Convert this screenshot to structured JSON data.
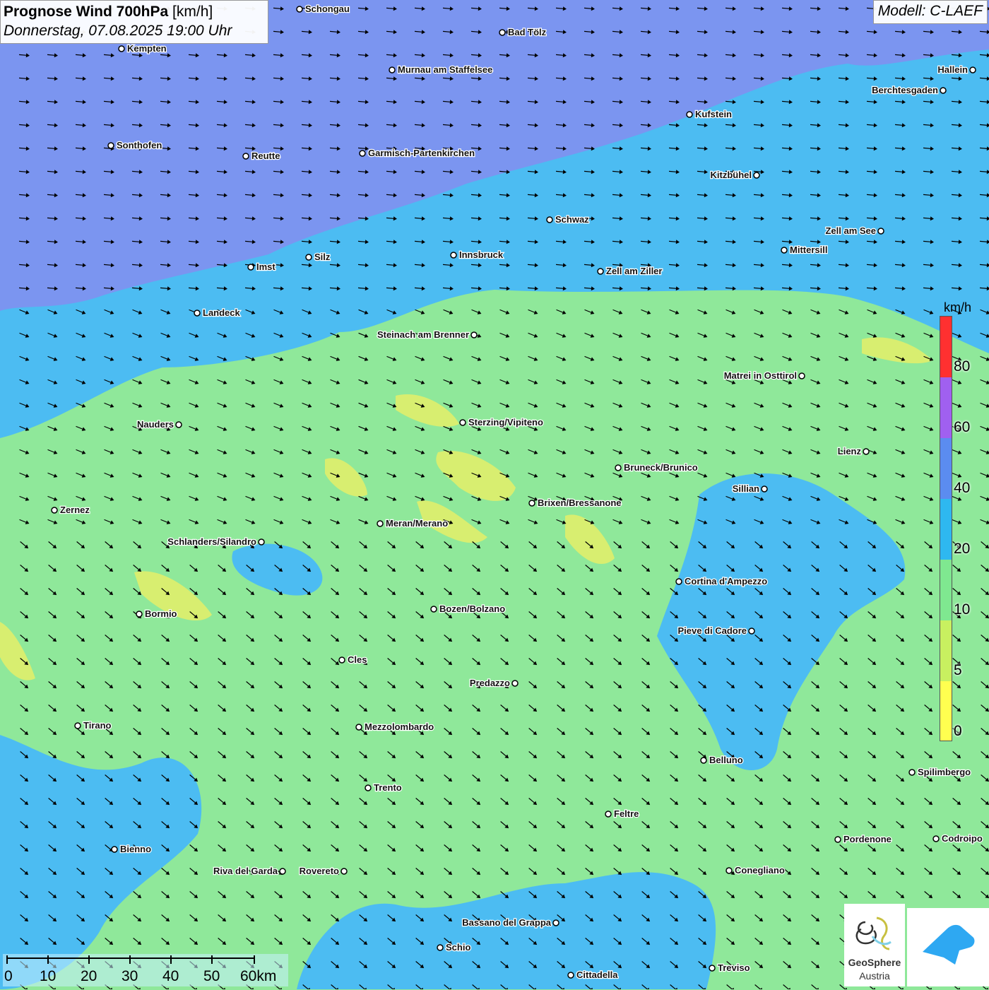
{
  "title": {
    "main_bold": "Prognose Wind 700hPa",
    "unit": "[km/h]",
    "datetime": "Donnerstag, 07.08.2025 19:00 Uhr"
  },
  "model": "Modell: C-LAEF",
  "legend": {
    "unit": "km/h",
    "ticks": [
      "80",
      "60",
      "40",
      "20",
      "10",
      "5",
      "0"
    ],
    "colors": [
      "#ff3030",
      "#a060f0",
      "#5b8cf0",
      "#2eb8f0",
      "#7fe890",
      "#c8f060",
      "#ffff50"
    ]
  },
  "scalebar": {
    "labels": [
      "0",
      "10",
      "20",
      "30",
      "40",
      "50",
      "60km"
    ]
  },
  "colors": {
    "wind_strong": "#7b95f0",
    "wind_medium": "#4cbcf2",
    "wind_light": "#8fe89a",
    "wind_calm": "#d8ee70",
    "arrow": "#000000"
  },
  "cities": [
    {
      "name": "Schongau"
    },
    {
      "name": "Bad Tölz"
    },
    {
      "name": "Kempten"
    },
    {
      "name": "Murnau am Staffelsee"
    },
    {
      "name": "Hallein"
    },
    {
      "name": "Berchtesgaden"
    },
    {
      "name": "Kufstein"
    },
    {
      "name": "Sonthofen"
    },
    {
      "name": "Reutte"
    },
    {
      "name": "Garmisch-Partenkirchen"
    },
    {
      "name": "Kitzbühel"
    },
    {
      "name": "Schwaz"
    },
    {
      "name": "Zell am See"
    },
    {
      "name": "Mittersill"
    },
    {
      "name": "Imst"
    },
    {
      "name": "Silz"
    },
    {
      "name": "Innsbruck"
    },
    {
      "name": "Zell am Ziller"
    },
    {
      "name": "Landeck"
    },
    {
      "name": "Steinach am Brenner"
    },
    {
      "name": "Matrei in Osttirol"
    },
    {
      "name": "Nauders"
    },
    {
      "name": "Sterzing/Vipiteno"
    },
    {
      "name": "Lienz"
    },
    {
      "name": "Bruneck/Brunico"
    },
    {
      "name": "Sillian"
    },
    {
      "name": "Brixen/Bressanone"
    },
    {
      "name": "Zernez"
    },
    {
      "name": "Meran/Merano"
    },
    {
      "name": "Schlanders/Silandro"
    },
    {
      "name": "Cortina d'Ampezzo"
    },
    {
      "name": "Bozen/Bolzano"
    },
    {
      "name": "Bormio"
    },
    {
      "name": "Pieve di Cadore"
    },
    {
      "name": "Cles"
    },
    {
      "name": "Predazzo"
    },
    {
      "name": "Tirano"
    },
    {
      "name": "Mezzolombardo"
    },
    {
      "name": "Belluno"
    },
    {
      "name": "Spilimbergo"
    },
    {
      "name": "Trento"
    },
    {
      "name": "Feltre"
    },
    {
      "name": "Pordenone"
    },
    {
      "name": "Codroipo"
    },
    {
      "name": "Bienno"
    },
    {
      "name": "Riva del Garda"
    },
    {
      "name": "Rovereto"
    },
    {
      "name": "Conegliano"
    },
    {
      "name": "Bassano del Grappa"
    },
    {
      "name": "Schio"
    },
    {
      "name": "Treviso"
    },
    {
      "name": "Cittadella"
    }
  ],
  "logo": {
    "line1": "GeoSphere",
    "line2": "Austria"
  }
}
